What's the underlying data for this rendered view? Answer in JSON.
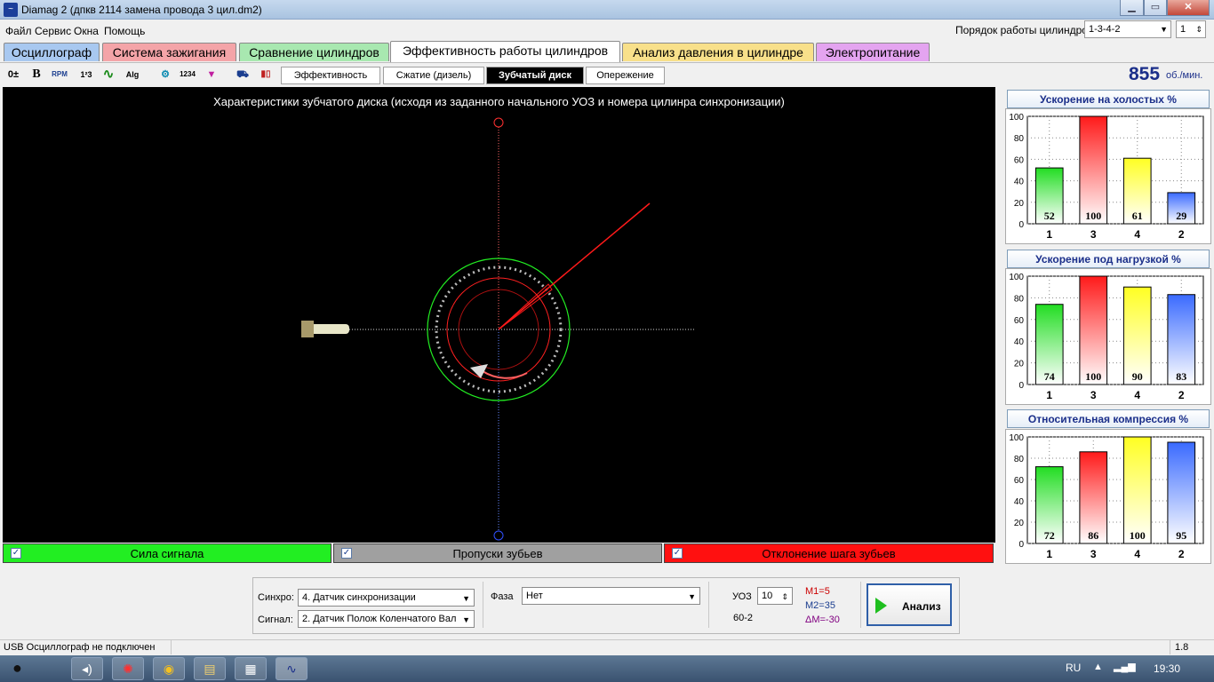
{
  "window": {
    "title": "Diamag 2 (дпкв 2114 замена провода 3 цил.dm2)"
  },
  "menu": [
    "Файл",
    "Сервис",
    "Окна",
    "Помощь"
  ],
  "cylinder_order": {
    "label": "Порядок работы цилиндров",
    "value": "1-3-4-2",
    "spin_value": "1"
  },
  "main_tabs": [
    {
      "label": "Осциллограф",
      "color": "#a8c8f0"
    },
    {
      "label": "Система зажигания",
      "color": "#f4a4a8"
    },
    {
      "label": "Сравнение цилиндров",
      "color": "#a8e8b0"
    },
    {
      "label": "Эффективность работы цилиндров",
      "color": "#ffffff"
    },
    {
      "label": "Анализ давления в цилиндре",
      "color": "#f8e08a"
    },
    {
      "label": "Электропитание",
      "color": "#e4a4f0"
    }
  ],
  "toolbar_icons": [
    "0±",
    "B",
    "RPM",
    "123",
    "~",
    "Alg",
    "net",
    "1234",
    "flt",
    "cars",
    "bar"
  ],
  "sub_tabs": [
    "Эффективность",
    "Сжатие (дизель)",
    "Зубчатый диск",
    "Опережение"
  ],
  "rpm": {
    "value": "855",
    "unit": "об./мин."
  },
  "canvas": {
    "title": "Характеристики зубчатого диска (исходя из заданного начального УОЗ и номера цилинра синхронизации)"
  },
  "legend": [
    {
      "label": "Сила сигнала",
      "color": "#22ee22",
      "checked": true
    },
    {
      "label": "Пропуски зубьев",
      "color": "#a0a0a0",
      "checked": true
    },
    {
      "label": "Отклонение шага зубьев",
      "color": "#ff1010",
      "checked": true
    }
  ],
  "chart_data": [
    {
      "type": "bar",
      "title": "Ускорение на холостых %",
      "categories": [
        "1",
        "3",
        "4",
        "2"
      ],
      "values": [
        52,
        100,
        61,
        29
      ],
      "ylim": [
        0,
        100
      ],
      "yticks": [
        0,
        20,
        40,
        60,
        80,
        100
      ],
      "colors": [
        "#22dd22",
        "#ff1a1a",
        "#ffff22",
        "#3a6aff"
      ]
    },
    {
      "type": "bar",
      "title": "Ускорение под нагрузкой %",
      "categories": [
        "1",
        "3",
        "4",
        "2"
      ],
      "values": [
        74,
        100,
        90,
        83
      ],
      "ylim": [
        0,
        100
      ],
      "yticks": [
        0,
        20,
        40,
        60,
        80,
        100
      ],
      "colors": [
        "#22dd22",
        "#ff1a1a",
        "#ffff22",
        "#3a6aff"
      ]
    },
    {
      "type": "bar",
      "title": "Относительная компрессия %",
      "categories": [
        "1",
        "3",
        "4",
        "2"
      ],
      "values": [
        72,
        86,
        100,
        95
      ],
      "ylim": [
        0,
        100
      ],
      "yticks": [
        0,
        20,
        40,
        60,
        80,
        100
      ],
      "colors": [
        "#22dd22",
        "#ff1a1a",
        "#ffff22",
        "#3a6aff"
      ]
    }
  ],
  "controls": {
    "sync_label": "Синхро:",
    "sync_value": "4.  Датчик синхронизации",
    "signal_label": "Сигнал:",
    "signal_value": "2.  Датчик Полож Коленчатого Вал",
    "phase_label": "Фаза",
    "phase_value": "Нет",
    "uoz_label": "УОЗ",
    "uoz_value": "10",
    "teeth": "60-2",
    "m1": "M1=5",
    "m2": "M2=35",
    "dm": "ΔM=-30",
    "analyze": "Анализ"
  },
  "status": {
    "text": "USB Осциллограф не подключен",
    "version": "1.8"
  },
  "taskbar": {
    "lang": "RU",
    "clock": "19:30"
  }
}
